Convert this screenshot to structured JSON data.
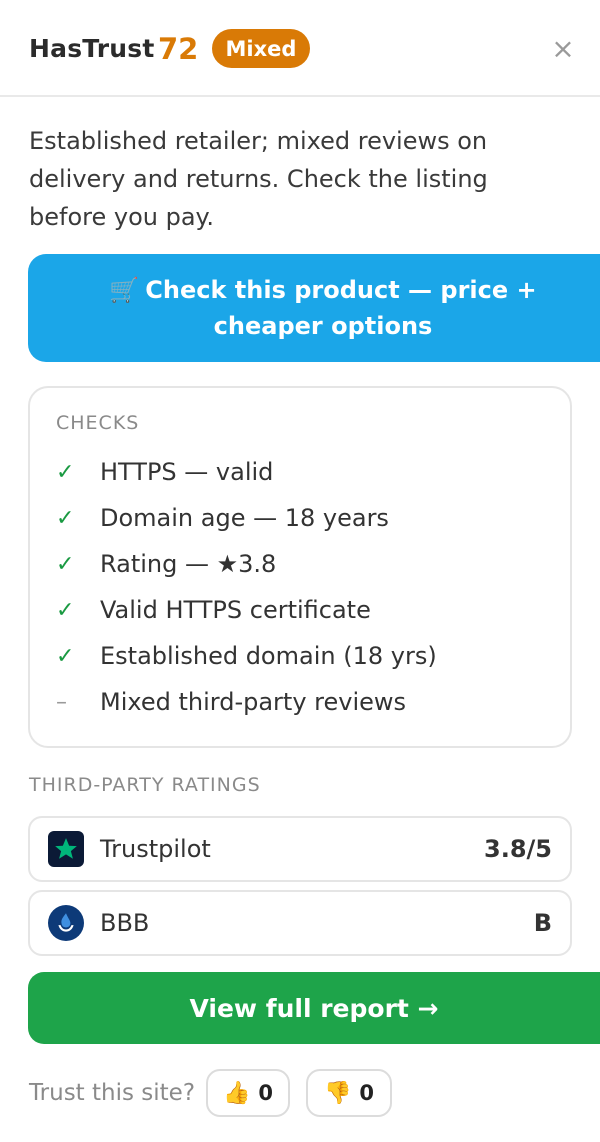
{
  "header": {
    "brand": "HasTrust",
    "score": "72",
    "badge": "Mixed",
    "close_glyph": "×",
    "accent_color": "#d97a06"
  },
  "summary": {
    "lines": [
      "Established retailer; mixed reviews on",
      "delivery and returns. Check the listing",
      "before you pay."
    ]
  },
  "cta": {
    "icon": "shopping-cart-icon",
    "glyph": "🛒",
    "label": "Check this product — price + cheaper options",
    "color": "#1ba6e8"
  },
  "checks": {
    "title": "CHECKS",
    "items": [
      {
        "mark": "✓",
        "status": "pass",
        "label": "HTTPS — valid"
      },
      {
        "mark": "✓",
        "status": "pass",
        "label": "Domain age — 18 years"
      },
      {
        "mark": "✓",
        "status": "pass",
        "label": "Rating — ★3.8"
      },
      {
        "mark": "✓",
        "status": "pass",
        "label": "Valid HTTPS certificate"
      },
      {
        "mark": "✓",
        "status": "pass",
        "label": "Established domain (18 yrs)"
      },
      {
        "mark": "–",
        "status": "neutral",
        "label": "Mixed third-party reviews"
      }
    ],
    "pass_color": "#1a9a42"
  },
  "ratings": {
    "title": "THIRD-PARTY RATINGS",
    "items": [
      {
        "name": "Trustpilot",
        "value": "3.8/5",
        "icon": "trustpilot-star-icon"
      },
      {
        "name": "BBB",
        "value": "B",
        "icon": "bbb-flame-icon"
      }
    ]
  },
  "report": {
    "label": "View full report →",
    "color": "#1ea44a"
  },
  "feedback": {
    "question": "Trust this site?",
    "up_glyph": "👍",
    "up_count": "0",
    "down_glyph": "👎",
    "down_count": "0"
  }
}
